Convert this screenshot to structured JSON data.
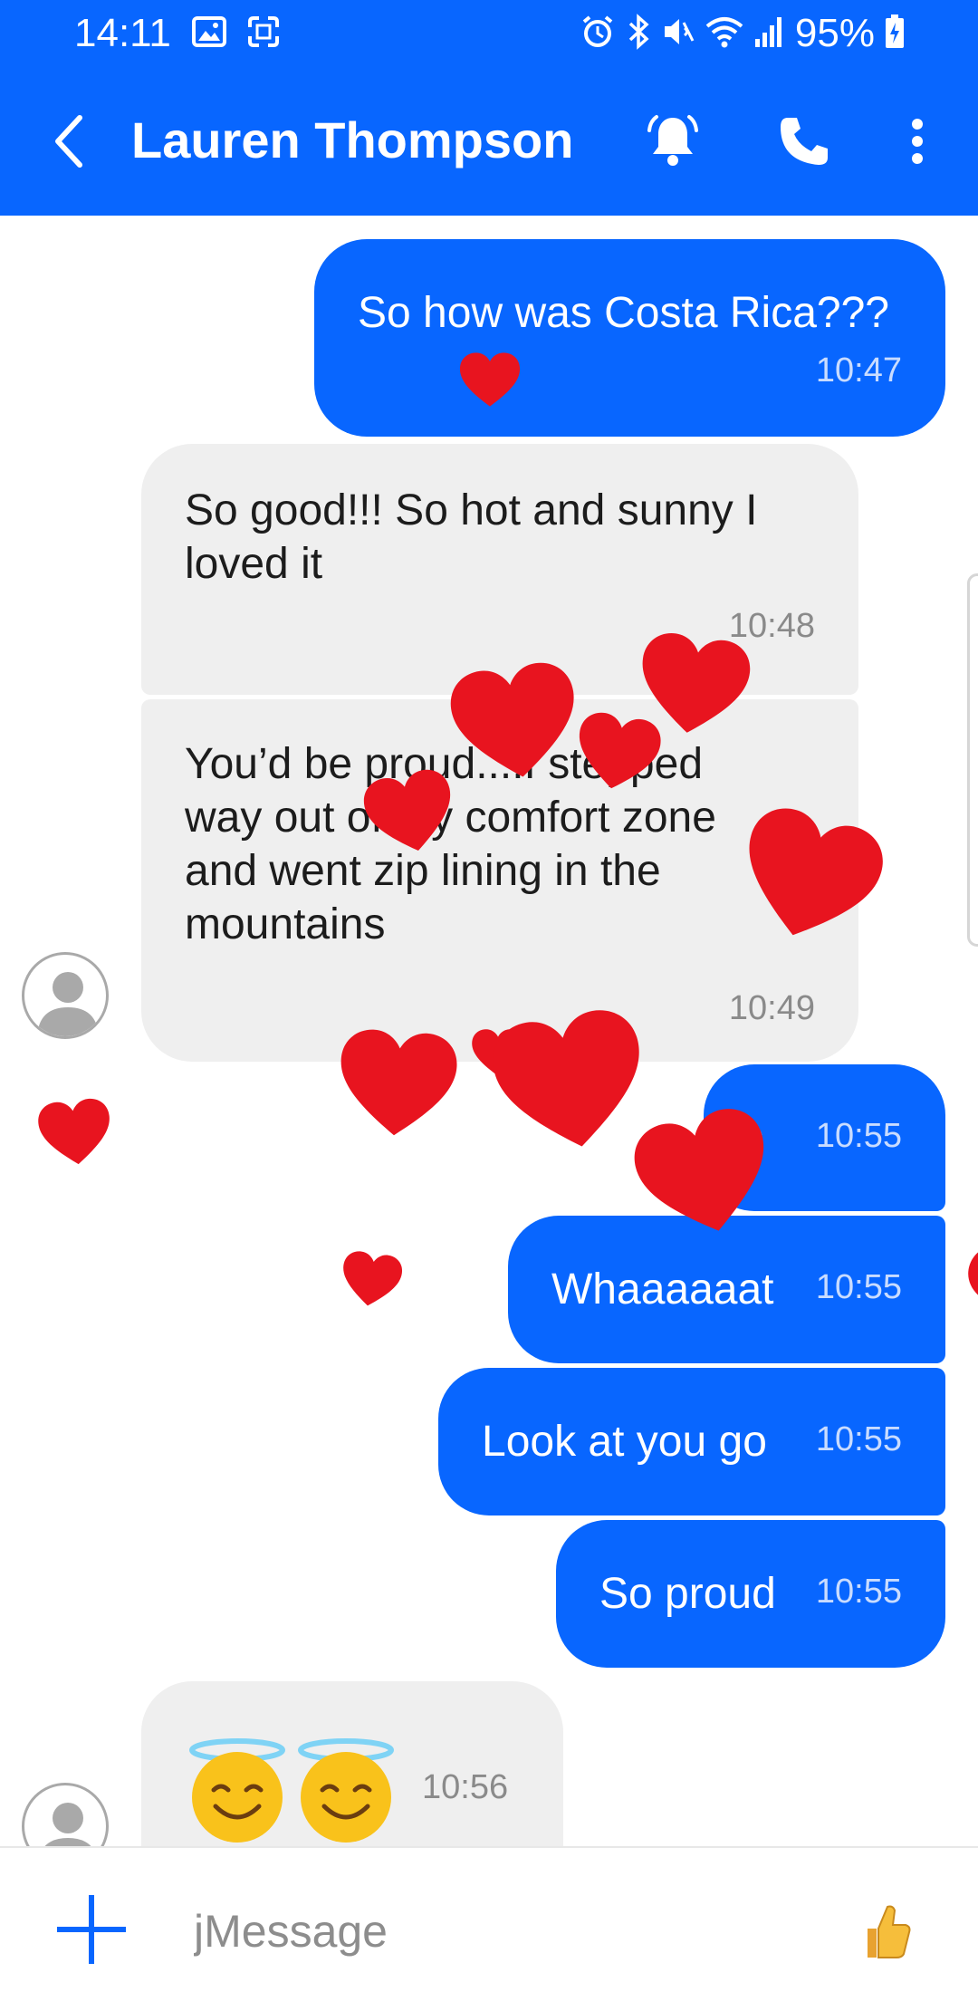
{
  "status_bar": {
    "time": "14:11",
    "battery": "95%",
    "left_icons": [
      "gallery-icon",
      "screenshot-icon"
    ],
    "right_icons": [
      "alarm-icon",
      "bluetooth-icon",
      "mute-icon",
      "wifi-icon",
      "signal-icon",
      "battery-charging-icon"
    ]
  },
  "header": {
    "contact_name": "Lauren Thompson",
    "icons": [
      "back-arrow-icon",
      "bell-icon",
      "phone-icon",
      "more-vert-icon"
    ]
  },
  "messages": [
    {
      "direction": "sent",
      "text": "So how was Costa Rica???",
      "time": "10:47"
    },
    {
      "direction": "received",
      "text": "So good!!! So hot and sunny I loved it",
      "time": "10:48"
    },
    {
      "direction": "received",
      "text": "You’d be proud....I stepped way out of my comfort zone and went zip lining in the mountains",
      "time": "10:49"
    },
    {
      "direction": "sent",
      "text": "o",
      "time": "10:55"
    },
    {
      "direction": "sent",
      "text": "Whaaaaaat",
      "time": "10:55"
    },
    {
      "direction": "sent",
      "text": "Look at you go",
      "time": "10:55"
    },
    {
      "direction": "sent",
      "text": "So proud",
      "time": "10:55"
    },
    {
      "direction": "received",
      "text": "😇😇",
      "time": "10:56"
    }
  ],
  "composer": {
    "placeholder": "jMessage",
    "icons": [
      "plus-icon",
      "thumbs-up-icon"
    ]
  },
  "effect": {
    "name": "hearts",
    "heart_color": "#e8141f"
  },
  "colors": {
    "accent": "#0866ff",
    "received_bubble": "#efefef"
  }
}
